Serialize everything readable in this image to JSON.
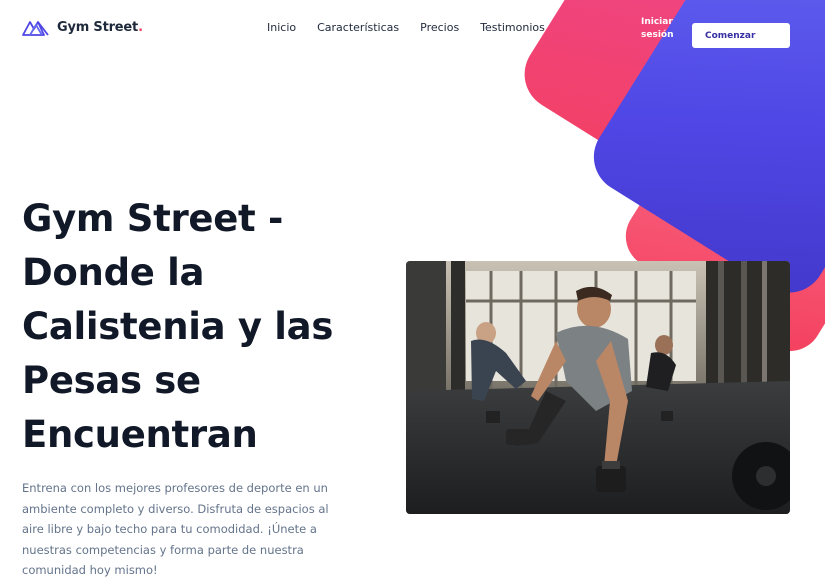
{
  "brand": {
    "name": "Gym Street",
    "dot": ".",
    "icon": "mountain-peaks-logo-icon"
  },
  "nav": {
    "items": [
      {
        "label": "Inicio"
      },
      {
        "label": "Características"
      },
      {
        "label": "Precios"
      },
      {
        "label": "Testimonios"
      }
    ]
  },
  "header_actions": {
    "login_label": "Iniciar sesión",
    "start_label": "Comenzar"
  },
  "hero": {
    "title": "Gym Street - Donde la Calistenia y las Pesas se Encuentran",
    "description": "Entrena con los mejores profesores de deporte en un ambiente completo y diverso. Disfruta de espacios al aire libre y bajo techo para tu comodidad. ¡Únete a nuestras competencias y forma parte de nuestra comunidad hoy mismo!",
    "image_icon": "gym-training-photo"
  },
  "colors": {
    "accent_blue": "#4f46e5",
    "accent_pink": "#ec4899",
    "accent_coral": "#f43f5e",
    "text_dark": "#111827",
    "text_muted": "#64748b"
  }
}
